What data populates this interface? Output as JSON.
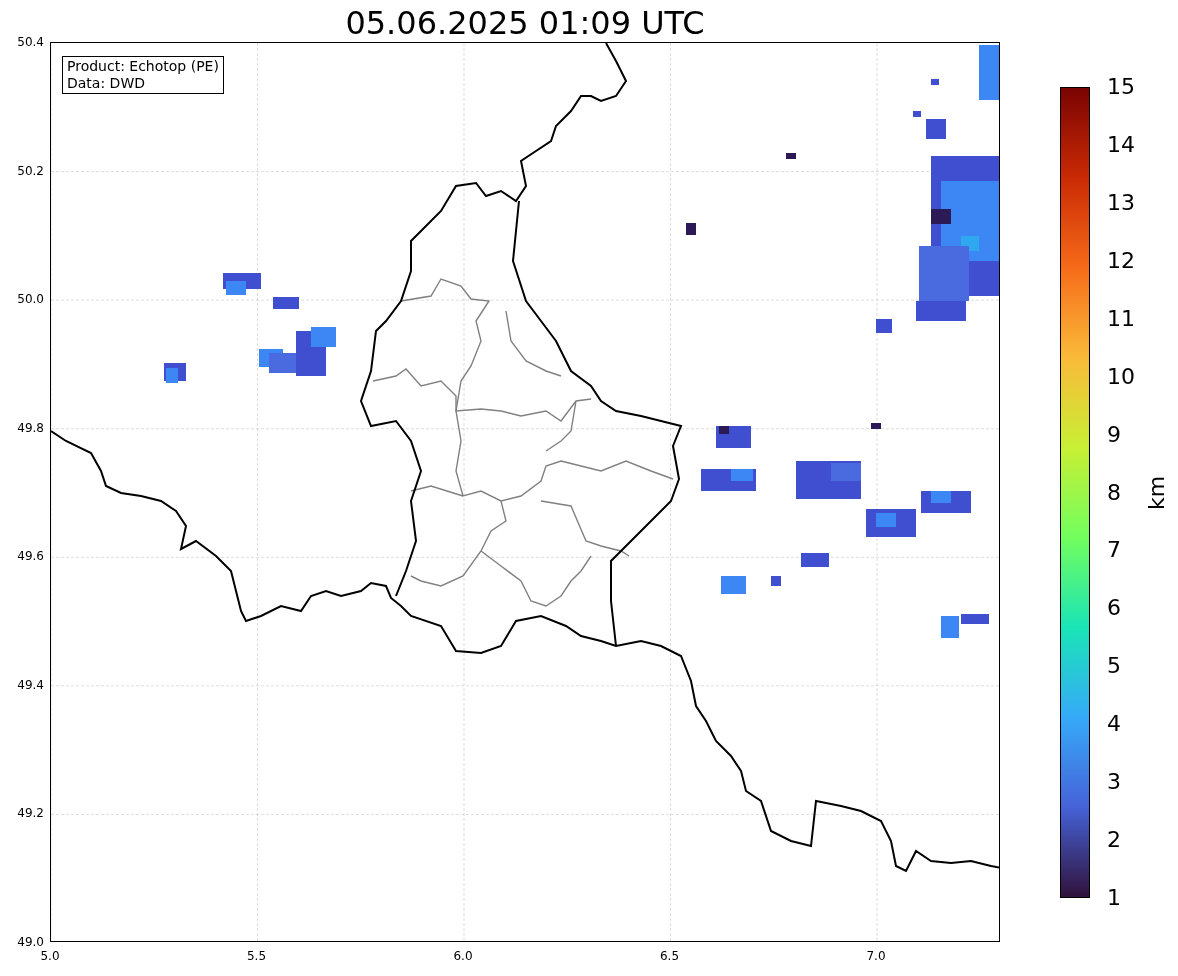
{
  "title": "05.06.2025 01:09 UTC",
  "annotation": [
    "Product: Echotop (PE)",
    "Data: DWD"
  ],
  "y_ticks": [
    "50.4",
    "50.2",
    "50.0",
    "49.8",
    "49.6",
    "49.4",
    "49.2",
    "49.0"
  ],
  "x_ticks": [
    "5.0",
    "5.5",
    "6.0",
    "6.5",
    "7.0"
  ],
  "colorbar": {
    "label": "km",
    "ticks": [
      "15",
      "14",
      "13",
      "12",
      "11",
      "10",
      "9",
      "8",
      "7",
      "6",
      "5",
      "4",
      "3",
      "2",
      "1"
    ]
  }
}
